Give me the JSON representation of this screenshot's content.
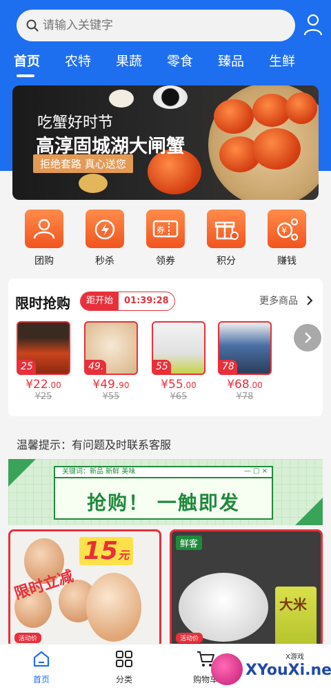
{
  "search": {
    "placeholder": "请输入关键字"
  },
  "tabs": [
    "首页",
    "农特",
    "果蔬",
    "零食",
    "臻品",
    "生鲜"
  ],
  "banner": {
    "line1": "吃蟹好时节",
    "line2": "高淳固城湖大闸蟹",
    "line3": "拒绝套路 真心送您"
  },
  "categories": [
    {
      "label": "团购",
      "icon": "group-buy-icon"
    },
    {
      "label": "秒杀",
      "icon": "flash-sale-icon"
    },
    {
      "label": "领券",
      "icon": "coupon-icon"
    },
    {
      "label": "积分",
      "icon": "points-icon"
    },
    {
      "label": "赚钱",
      "icon": "earn-money-icon"
    }
  ],
  "flash_sale": {
    "title": "限时抢购",
    "countdown_label": "距开始",
    "countdown_time": "01:39:28",
    "more": "更多商品",
    "products": [
      {
        "tag": "25",
        "price": "¥22",
        "price_decimal": ".00",
        "old_price": "¥25"
      },
      {
        "tag": "49.",
        "price": "¥49.",
        "price_decimal": "90",
        "old_price": "¥55"
      },
      {
        "tag": "55",
        "price": "¥55",
        "price_decimal": ".00",
        "old_price": "¥65"
      },
      {
        "tag": "78",
        "price": "¥68",
        "price_decimal": ".00",
        "old_price": "¥78"
      }
    ]
  },
  "tip": "温馨提示：有问题及时联系客服",
  "promo": {
    "bar_text": "关键词：新品 新鲜 美味",
    "window_buttons": "— □ ×",
    "slogan": "抢购！ 一触即发"
  },
  "cards": {
    "egg": {
      "badge": "15",
      "badge_unit": "元",
      "hint": "限时立减",
      "small": "活动价"
    },
    "rice": {
      "brand": "鲜客",
      "bag_text": "大米",
      "small": "活动价"
    }
  },
  "bottom_nav": [
    {
      "label": "首页",
      "icon": "home-icon"
    },
    {
      "label": "分类",
      "icon": "category-grid-icon"
    },
    {
      "label": "购物车",
      "icon": "cart-icon"
    }
  ],
  "watermark": {
    "text": "XYouXi.net",
    "small": "X游戏"
  },
  "colors": {
    "primary": "#1e6ef0",
    "accent": "#e8303a",
    "orange": "#f1541f",
    "green": "#1f8a3c"
  }
}
